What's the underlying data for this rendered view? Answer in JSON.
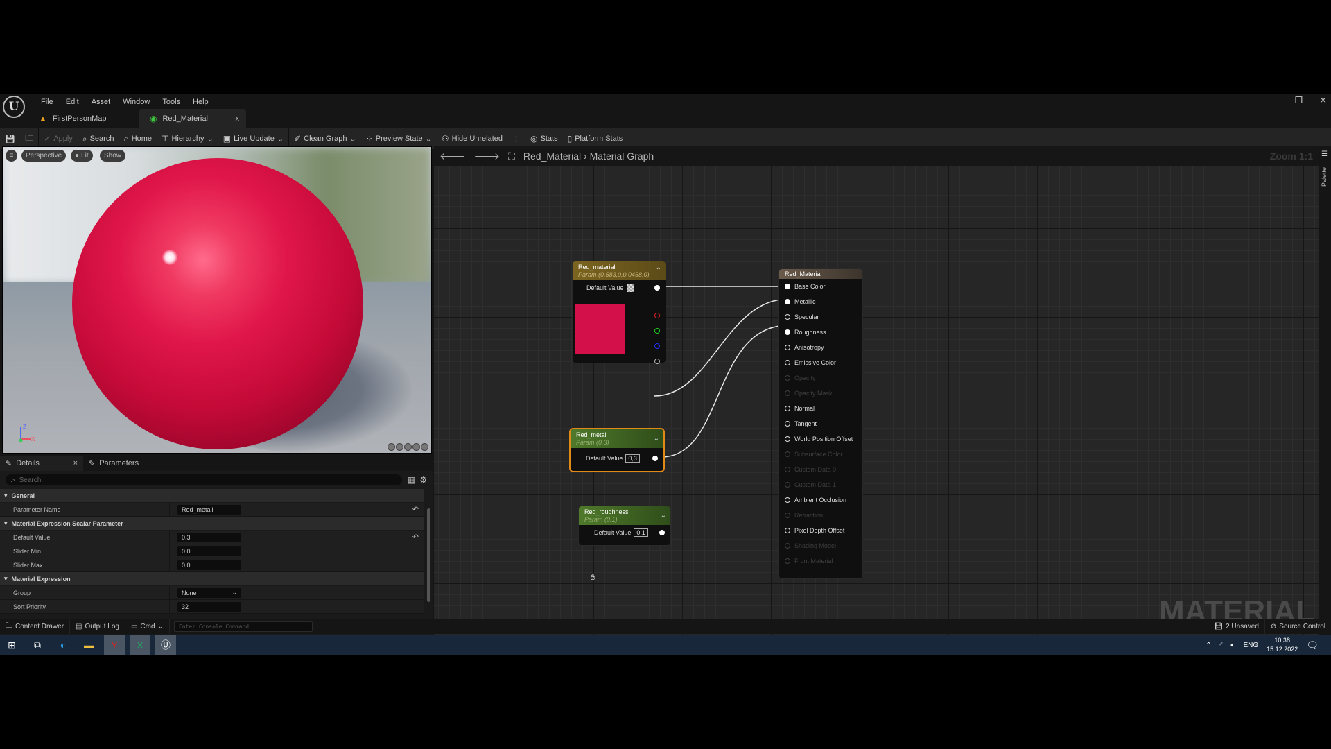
{
  "menu": [
    "File",
    "Edit",
    "Asset",
    "Window",
    "Tools",
    "Help"
  ],
  "doc_tabs": [
    {
      "label": "FirstPersonMap",
      "icon": "level-icon",
      "active": false
    },
    {
      "label": "Red_Material",
      "icon": "material-icon",
      "active": true,
      "close": "x"
    }
  ],
  "window_controls": {
    "minimize": "—",
    "restore": "❐",
    "close": "✕"
  },
  "toolbar": {
    "apply": "Apply",
    "search": "Search",
    "home": "Home",
    "hierarchy": "Hierarchy",
    "live_update": "Live Update",
    "clean_graph": "Clean Graph",
    "preview_state": "Preview State",
    "hide_unrelated": "Hide Unrelated",
    "stats": "Stats",
    "platform_stats": "Platform Stats"
  },
  "viewport": {
    "perspective": "Perspective",
    "lit": "Lit",
    "show": "Show",
    "axis_x": "X",
    "axis_z": "Z"
  },
  "details": {
    "tabs": [
      {
        "label": "Details",
        "close": "×"
      },
      {
        "label": "Parameters"
      }
    ],
    "search_placeholder": "Search",
    "sections": {
      "general": "General",
      "scalar": "Material Expression Scalar Parameter",
      "expression": "Material Expression"
    },
    "rows": {
      "parameter_name": {
        "label": "Parameter Name",
        "value": "Red_metall"
      },
      "default_value": {
        "label": "Default Value",
        "value": "0,3"
      },
      "slider_min": {
        "label": "Slider Min",
        "value": "0,0"
      },
      "slider_max": {
        "label": "Slider Max",
        "value": "0,0"
      },
      "group": {
        "label": "Group",
        "value": "None"
      },
      "sort_priority": {
        "label": "Sort Priority",
        "value": "32"
      }
    }
  },
  "graph": {
    "breadcrumb_root": "Red_Material",
    "breadcrumb_sep": "›",
    "breadcrumb_leaf": "Material Graph",
    "zoom": "Zoom 1:1",
    "watermark": "MATERIAL",
    "palette": "Palette",
    "nodes": {
      "color": {
        "title": "Red_material",
        "subtitle": "Param (0.583,0,0.0458,0)",
        "default_label": "Default Value",
        "swatch": "#d4104a"
      },
      "metal": {
        "title": "Red_metall",
        "subtitle": "Param (0.3)",
        "default_label": "Default Value",
        "value": "0,3"
      },
      "rough": {
        "title": "Red_roughness",
        "subtitle": "Param (0.1)",
        "default_label": "Default Value",
        "value": "0,1"
      },
      "result": {
        "title": "Red_Material",
        "pins": [
          {
            "label": "Base Color",
            "state": "connected"
          },
          {
            "label": "Metallic",
            "state": "connected"
          },
          {
            "label": "Specular",
            "state": "enabled"
          },
          {
            "label": "Roughness",
            "state": "connected"
          },
          {
            "label": "Anisotropy",
            "state": "enabled"
          },
          {
            "label": "Emissive Color",
            "state": "enabled"
          },
          {
            "label": "Opacity",
            "state": "disabled"
          },
          {
            "label": "Opacity Mask",
            "state": "disabled"
          },
          {
            "label": "Normal",
            "state": "enabled"
          },
          {
            "label": "Tangent",
            "state": "enabled"
          },
          {
            "label": "World Position Offset",
            "state": "enabled"
          },
          {
            "label": "Subsurface Color",
            "state": "disabled"
          },
          {
            "label": "Custom Data 0",
            "state": "disabled"
          },
          {
            "label": "Custom Data 1",
            "state": "disabled"
          },
          {
            "label": "Ambient Occlusion",
            "state": "enabled"
          },
          {
            "label": "Refraction",
            "state": "disabled"
          },
          {
            "label": "Pixel Depth Offset",
            "state": "enabled"
          },
          {
            "label": "Shading Model",
            "state": "disabled"
          },
          {
            "label": "Front Material",
            "state": "disabled"
          }
        ]
      }
    }
  },
  "statusbar": {
    "content_drawer": "Content Drawer",
    "output_log": "Output Log",
    "cmd": "Cmd",
    "console_placeholder": "Enter Console Command",
    "unsaved": "2 Unsaved",
    "source_control": "Source Control"
  },
  "taskbar": {
    "lang": "ENG",
    "time": "10:38",
    "date": "15.12.2022"
  }
}
